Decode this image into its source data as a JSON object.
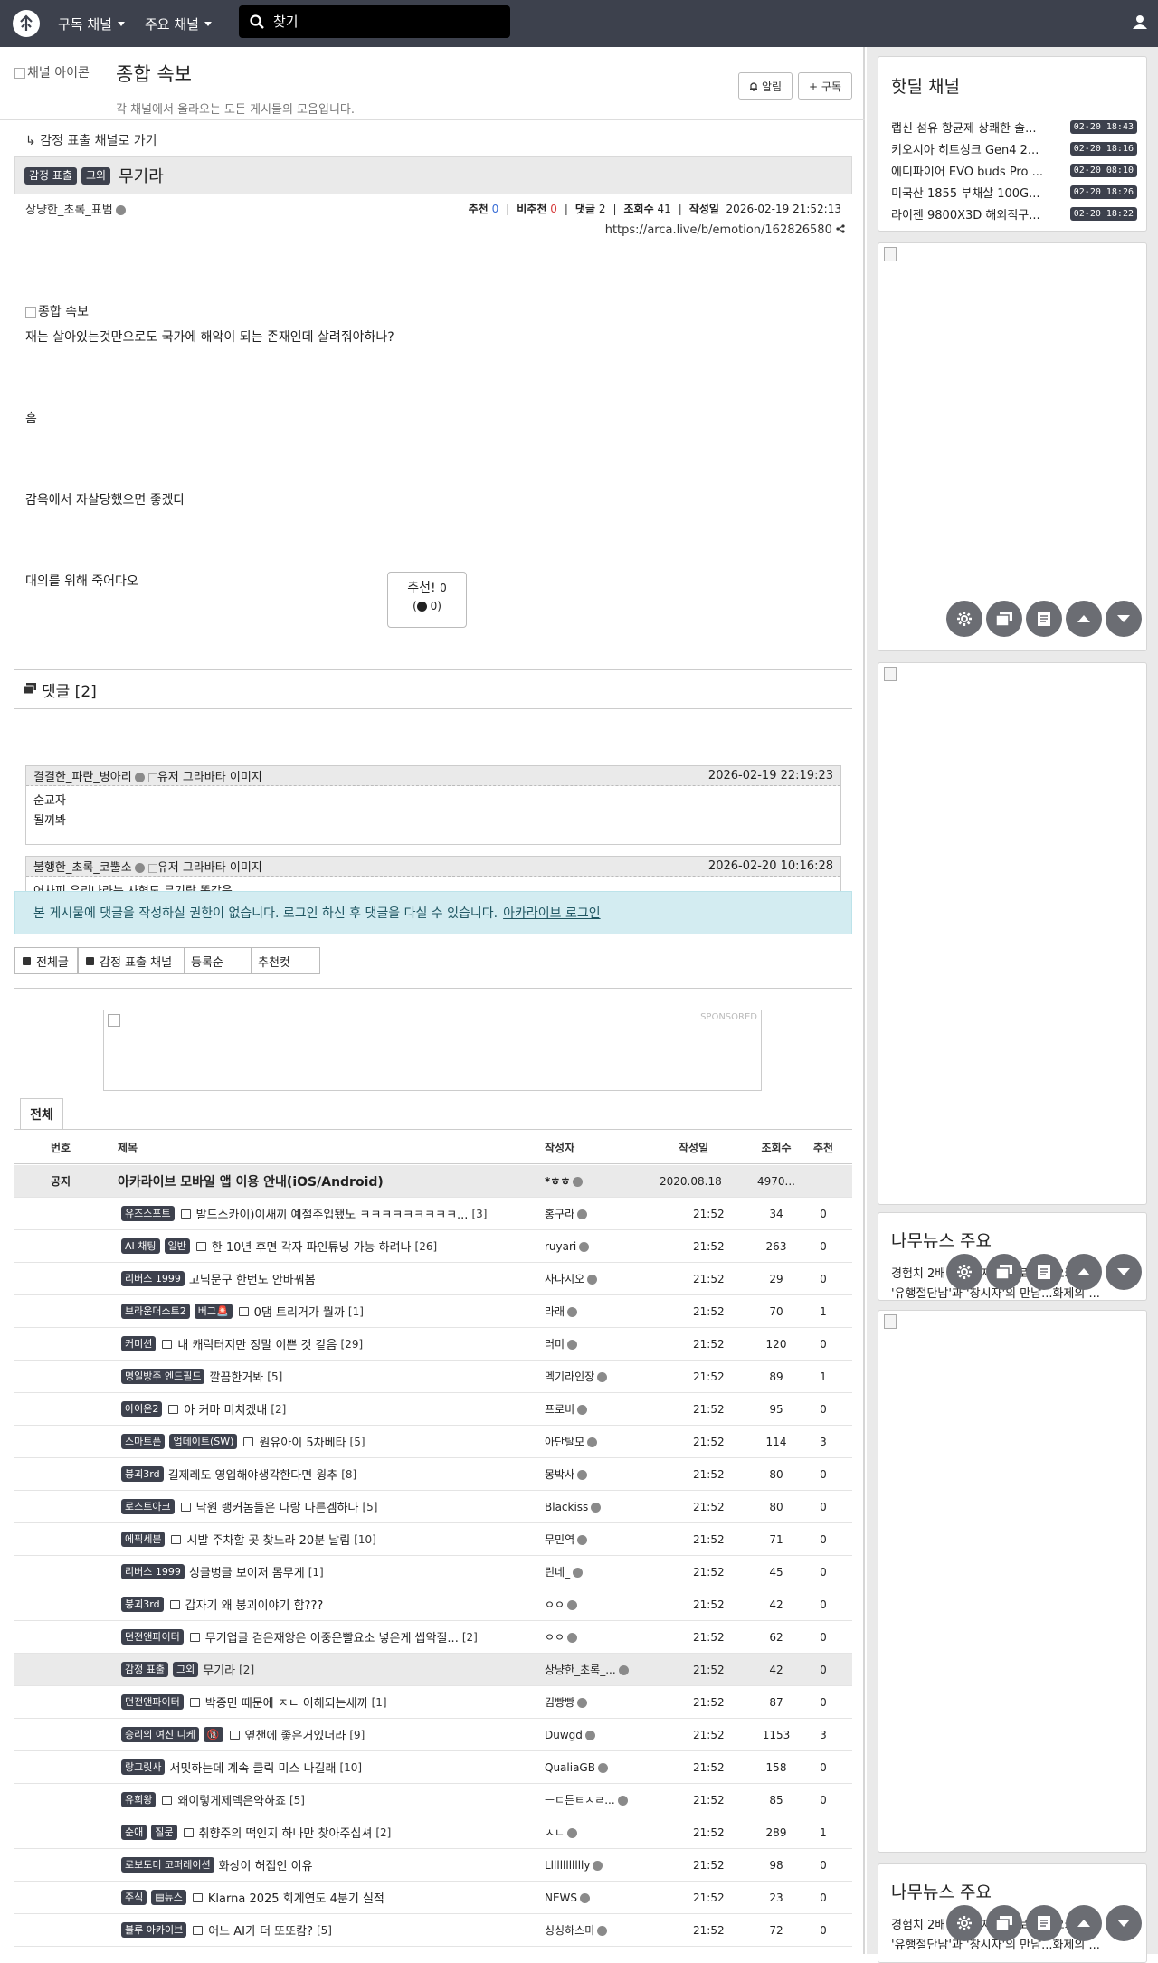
{
  "nav": {
    "menu1": "구독 채널",
    "menu2": "주요 채널",
    "search_placeholder": "찾기"
  },
  "board": {
    "image_alt": "채널 아이콘",
    "title": "종합 속보",
    "description": "각 채널에서 올라오는 모든 게시물의 모음입니다.",
    "alarm_label": "알림",
    "subscribe_label": "+ 구독"
  },
  "post": {
    "back_link": "감정 표출 채널로 가기",
    "badge1": "감정 표출",
    "badge2": "그외",
    "title": "무기라",
    "author": "상냥한_초록_표범",
    "labels": {
      "rec": "추천",
      "unrec": "비추천",
      "comments": "댓글",
      "views": "조회수",
      "date": "작성일"
    },
    "rec": "0",
    "unrec": "0",
    "comments": "2",
    "views": "41",
    "date": "2026-02-19 21:52:13",
    "url": "https://arca.live/b/emotion/162826580",
    "image_alt": "종합 속보",
    "lines": [
      "재는 살아있는것만으로도 국가에 해악이 되는 존재인데 살려줘야하나?",
      "흠",
      "감옥에서 자살당했으면 좋겠다",
      "대의를 위해 죽어다오"
    ],
    "rec_button": "추천!",
    "rec_button_count": "0",
    "unrec_count": "0)"
  },
  "comments_section": {
    "title": "댓글 [2]",
    "items": [
      {
        "author": "결결한_파란_병아리",
        "avatar_alt": "유저 그라바타 이미지",
        "date": "2026-02-19 22:19:23",
        "line1": "순교자",
        "line2": "될끼봐"
      },
      {
        "author": "불행한_초록_코뿔소",
        "avatar_alt": "유저 그라바타 이미지",
        "date": "2026-02-20 10:16:28",
        "line1": "어차피 우리나라는 사형도 무기랑 똑같음",
        "line2": ""
      }
    ],
    "alert_text": "본 게시물에 댓글을 작성하실 권한이 없습니다. 로그인 하신 후 댓글을 다실 수 있습니다.",
    "alert_link": "아카라이브 로그인"
  },
  "filters": {
    "all": "전체글",
    "channel": "감정 표출 채널",
    "order": "등록순",
    "rec": "추천컷"
  },
  "ad": {
    "label": "SPONSORED"
  },
  "list": {
    "tab": "전체",
    "headers": {
      "num": "번호",
      "title": "제목",
      "author": "작성자",
      "date": "작성일",
      "views": "조회수",
      "rec": "추천"
    },
    "notice": {
      "num": "공지",
      "title": "아카라이브 모바일 앱 이용 안내(iOS/Android)",
      "author": "*ㅎㅎ",
      "date": "2020.08.18",
      "views": "4970...",
      "rec": ""
    },
    "rows": [
      {
        "badges": [
          "유즈스포트"
        ],
        "title": "발드스카이)이새끼 예절주입됐노 ㅋㅋㅋㅋㅋㅋㅋㅋㅋ...",
        "cc": "[3]",
        "author": "홍구라",
        "time": "21:52",
        "views": "34",
        "rec": "0"
      },
      {
        "badges": [
          "AI 채팅",
          "일반"
        ],
        "title": "한 10년 후면 각자 파인튜닝 가능 하려나",
        "cc": "[26]",
        "author": "ruyari",
        "time": "21:52",
        "views": "263",
        "rec": "0"
      },
      {
        "badges": [
          "리버스 1999"
        ],
        "title": "고닉문구 한번도 안바꿔봄",
        "cc": "",
        "author": "사다시오",
        "time": "21:52",
        "views": "29",
        "rec": "0"
      },
      {
        "badges": [
          "브라운더스트2",
          "버그🚨"
        ],
        "title": "0댐 트리거가 뭘까",
        "cc": "[1]",
        "author": "라래",
        "time": "21:52",
        "views": "70",
        "rec": "1"
      },
      {
        "badges": [
          "커미션"
        ],
        "title": "내 캐릭터지만 정말 이쁜 것 같음",
        "cc": "[29]",
        "author": "러미",
        "time": "21:52",
        "views": "120",
        "rec": "0"
      },
      {
        "badges": [
          "명일방주 엔드필드"
        ],
        "title": "깔끔한거봐",
        "cc": "[5]",
        "author": "멕기라인장",
        "time": "21:52",
        "views": "89",
        "rec": "1"
      },
      {
        "badges": [
          "아이온2"
        ],
        "title": "아 커마 미치겠내",
        "cc": "[2]",
        "author": "프로비",
        "time": "21:52",
        "views": "95",
        "rec": "0"
      },
      {
        "badges": [
          "스마트폰",
          "업데이트(SW)"
        ],
        "title": "원유아이 5차베타",
        "cc": "[5]",
        "author": "아단탈모",
        "time": "21:52",
        "views": "114",
        "rec": "3"
      },
      {
        "badges": [
          "붕괴3rd"
        ],
        "title": "길제레도 영입해야생각한다면 윙추",
        "cc": "[8]",
        "author": "몽박사",
        "time": "21:52",
        "views": "80",
        "rec": "0"
      },
      {
        "badges": [
          "로스트아크"
        ],
        "title": "낙원 랭커놈들은 나랑 다른겜하나",
        "cc": "[5]",
        "author": "Blackiss",
        "time": "21:52",
        "views": "80",
        "rec": "0"
      },
      {
        "badges": [
          "에픽세븐"
        ],
        "title": "시발 주차할 곳 찾느라 20분 날림",
        "cc": "[10]",
        "author": "무민역",
        "time": "21:52",
        "views": "71",
        "rec": "0"
      },
      {
        "badges": [
          "리버스 1999"
        ],
        "title": "싱글벙글 보이저 몸무게",
        "cc": "[1]",
        "author": "린네_",
        "time": "21:52",
        "views": "45",
        "rec": "0"
      },
      {
        "badges": [
          "붕괴3rd"
        ],
        "title": "갑자기 왜 붕괴이야기 함???",
        "cc": "",
        "author": "ㅇㅇ",
        "time": "21:52",
        "views": "42",
        "rec": "0"
      },
      {
        "badges": [
          "던전앤파이터"
        ],
        "title": "무기업글 검은재앙은 이중운빨요소 넣은게 씹악질...",
        "cc": "[2]",
        "author": "ㅇㅇ",
        "time": "21:52",
        "views": "62",
        "rec": "0"
      },
      {
        "badges": [
          "감정 표출",
          "그외"
        ],
        "title": "무기라",
        "cc": "[2]",
        "author": "상냥한_초록_...",
        "time": "21:52",
        "views": "42",
        "rec": "0"
      },
      {
        "badges": [
          "던전앤파이터"
        ],
        "title": "박종민 때문에 ㅈㄴ 이해되는새끼",
        "cc": "[1]",
        "author": "김빵빵",
        "time": "21:52",
        "views": "87",
        "rec": "0"
      },
      {
        "badges": [
          "승리의 여신 니케",
          "🔞"
        ],
        "title": "옆챈에 좋은거있더라",
        "cc": "[9]",
        "author": "Duwgd",
        "time": "21:52",
        "views": "1153",
        "rec": "3"
      },
      {
        "badges": [
          "랑그릿사"
        ],
        "title": "서밋하는데 계속 클릭 미스 나길래",
        "cc": "[10]",
        "author": "QualiaGB",
        "time": "21:52",
        "views": "158",
        "rec": "0"
      },
      {
        "badges": [
          "유희왕"
        ],
        "title": "왜이렇게제덱은약하죠",
        "cc": "[5]",
        "author": "ㅡㄷ튼ㅌㅅㄹ...",
        "time": "21:52",
        "views": "85",
        "rec": "0"
      },
      {
        "badges": [
          "순애",
          "질문"
        ],
        "title": "취향주의 떡인지 하나만 찾아주십셔",
        "cc": "[2]",
        "author": "ㅅㄴ",
        "time": "21:52",
        "views": "289",
        "rec": "1"
      },
      {
        "badges": [
          "로보토미 코퍼레이션"
        ],
        "title": "화상이 허접인 이유",
        "cc": "",
        "author": "Lllllllllllly",
        "time": "21:52",
        "views": "98",
        "rec": "0"
      },
      {
        "badges": [
          "주식",
          "▤뉴스"
        ],
        "title": "Klarna 2025 회계연도 4분기 실적",
        "cc": "",
        "author": "NEWS",
        "time": "21:52",
        "views": "23",
        "rec": "0"
      },
      {
        "badges": [
          "블루 아카이브"
        ],
        "title": "어느 AI가 더 또또캄?",
        "cc": "[5]",
        "author": "싱싱하스미",
        "time": "21:52",
        "views": "72",
        "rec": "0"
      }
    ]
  },
  "sidebar": {
    "hot_title": "핫딜 채널",
    "hot_items": [
      {
        "title": "랩신 섬유 항균제 상쾌한 솔...",
        "date": "02-20 18:43"
      },
      {
        "title": "키오시아 히트싱크 Gen4 2...",
        "date": "02-20 18:16"
      },
      {
        "title": "에디파이어 EVO buds Pro ...",
        "date": "02-20 08:10"
      },
      {
        "title": "미국산 1855 부채살 100G...",
        "date": "02-20 18:26"
      },
      {
        "title": "라이젠 9800X3D 해외직구...",
        "date": "02-20 18:22"
      }
    ],
    "news_title": "나무뉴스 주요",
    "news_line1": "경험치 2배 '출현' 재생 프로모션 오카...",
    "news_line2": "'유행절단남'과 '창시자'의 만남...화제의 ...",
    "news2_title": "나무뉴스 주요",
    "news2_line1": "경험치 2배 '출현' 재생 프로모션 오카...",
    "news2_line2": "'유행절단남'과 '창시자'의 만남...화제의 ..."
  }
}
